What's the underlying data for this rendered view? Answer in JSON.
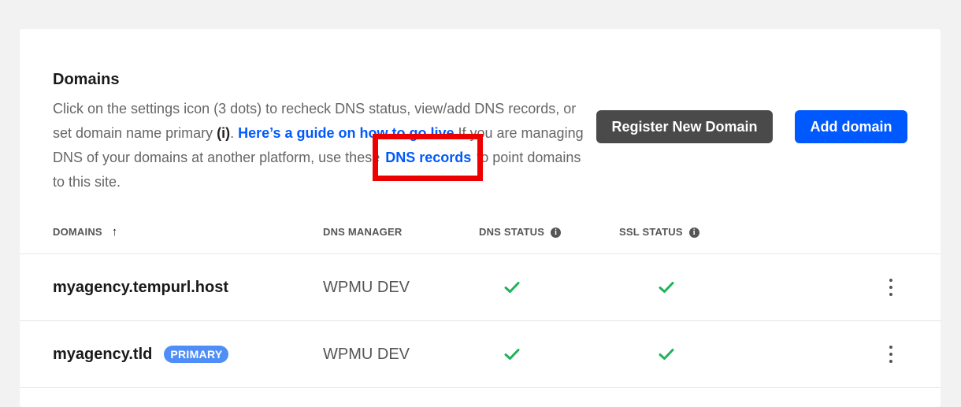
{
  "section": {
    "title": "Domains",
    "desc_part1": "Click on the settings icon (3 dots) to recheck DNS status, view/add DNS records, or set domain name primary ",
    "desc_bold": "(i)",
    "desc_part2": ". ",
    "guide_link": "Here’s a guide on how to go live",
    "desc_part3": " If you are managing DNS of your domains at another platform, use these ",
    "dns_link": "DNS records",
    "desc_part4": " to point domains to this site."
  },
  "buttons": {
    "register": "Register New Domain",
    "add": "Add domain"
  },
  "table": {
    "headers": {
      "domains": "DOMAINS",
      "dns_manager": "DNS MANAGER",
      "dns_status": "DNS STATUS",
      "ssl_status": "SSL STATUS"
    },
    "rows": [
      {
        "domain": "myagency.tempurl.host",
        "badge": "",
        "manager": "WPMU DEV",
        "dns_ok": true,
        "ssl_ok": true
      },
      {
        "domain": "myagency.tld",
        "badge": "PRIMARY",
        "manager": "WPMU DEV",
        "dns_ok": true,
        "ssl_ok": true
      }
    ]
  },
  "colors": {
    "accent": "#0059ff",
    "check": "#1fb25a",
    "highlight": "#ee0000"
  }
}
